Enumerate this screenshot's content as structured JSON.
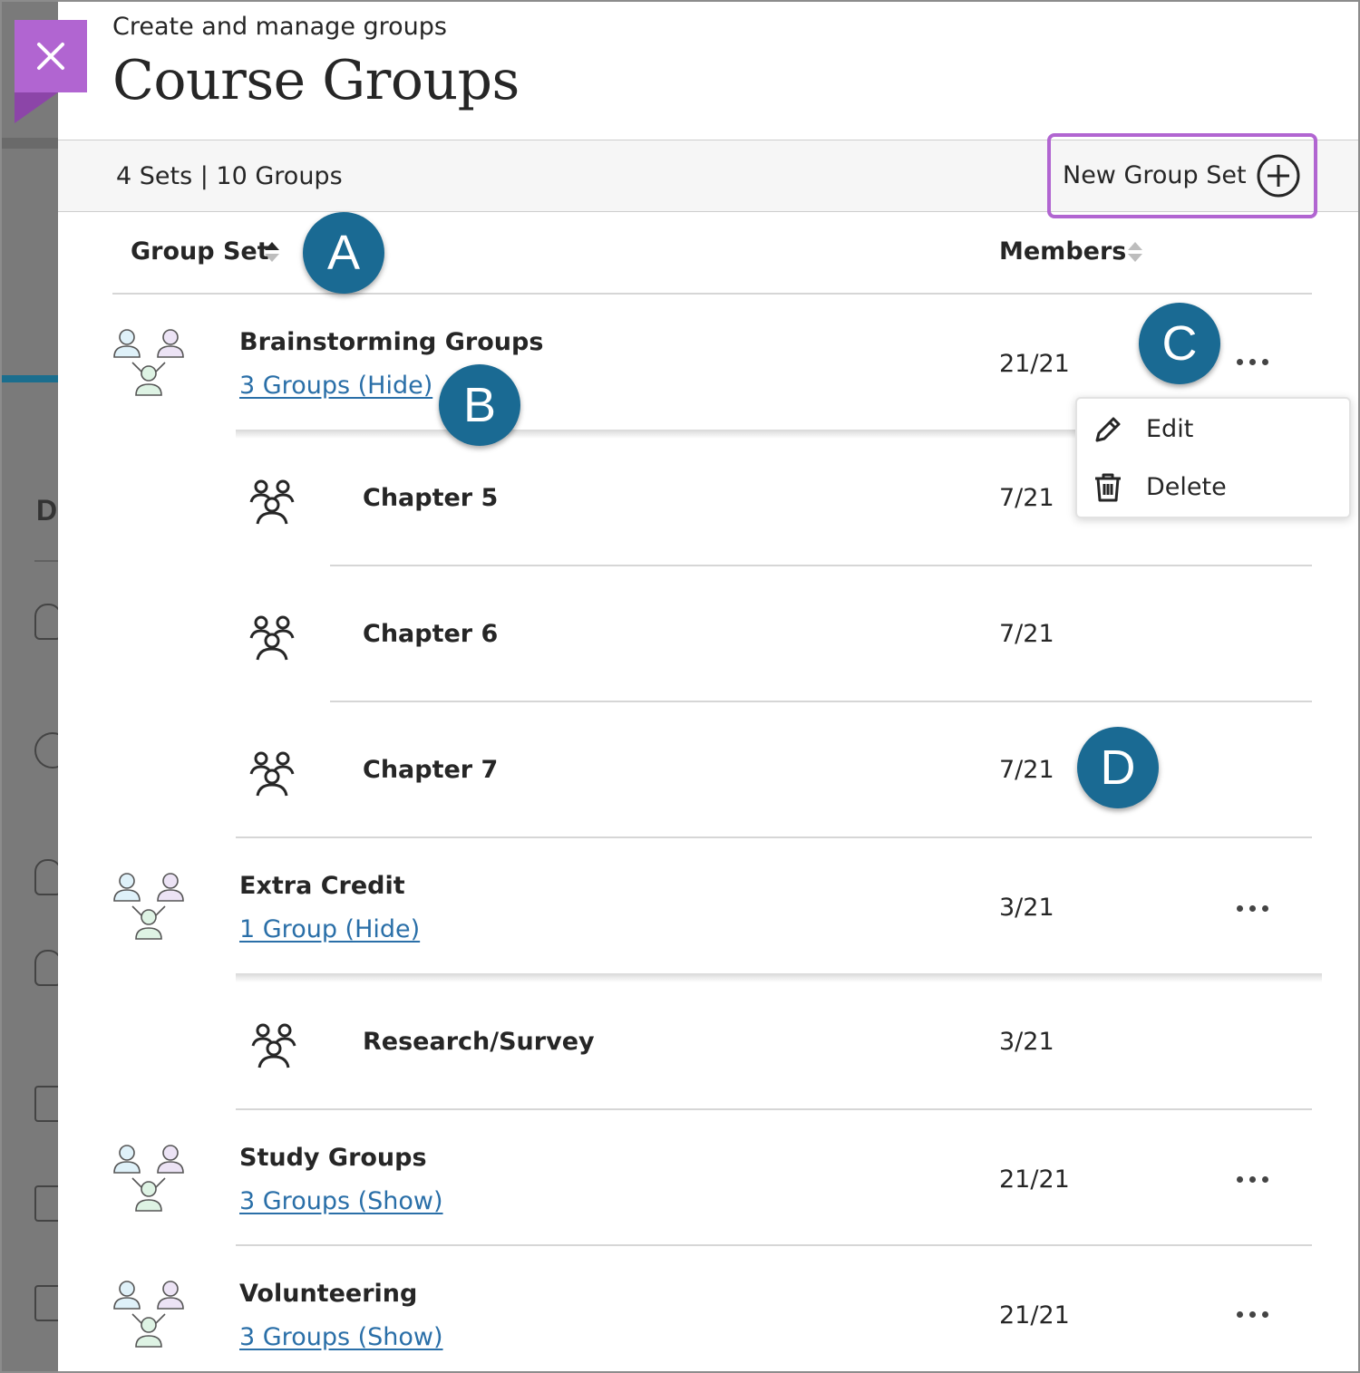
{
  "header": {
    "subtitle": "Create and manage groups",
    "title": "Course Groups"
  },
  "summary": {
    "text": "4 Sets | 10 Groups",
    "new_set_label": "New Group Set"
  },
  "columns": {
    "group_set": "Group Set",
    "members": "Members"
  },
  "callouts": [
    "A",
    "B",
    "C",
    "D"
  ],
  "sets": [
    {
      "name": "Brainstorming Groups",
      "link": "3 Groups (Hide)",
      "members": "21/21",
      "groups": [
        {
          "name": "Chapter 5",
          "members": "7/21"
        },
        {
          "name": "Chapter 6",
          "members": "7/21"
        },
        {
          "name": "Chapter 7",
          "members": "7/21"
        }
      ]
    },
    {
      "name": "Extra Credit",
      "link": "1 Group (Hide)",
      "members": "3/21",
      "groups": [
        {
          "name": "Research/Survey",
          "members": "3/21"
        }
      ]
    },
    {
      "name": "Study Groups",
      "link": "3 Groups (Show)",
      "members": "21/21",
      "groups": []
    },
    {
      "name": "Volunteering",
      "link": "3 Groups (Show)",
      "members": "21/21",
      "groups": []
    }
  ],
  "menu": {
    "edit": "Edit",
    "delete": "Delete"
  },
  "background": {
    "letter": "D"
  },
  "colors": {
    "accent_purple": "#b165d1",
    "callout_blue": "#1a6a93",
    "link_blue": "#2a6fa8"
  },
  "icons": [
    "close-icon",
    "plus-circle-icon",
    "sort-icon",
    "group-set-icon",
    "group-icon",
    "more-options-icon",
    "pencil-icon",
    "trash-icon"
  ]
}
